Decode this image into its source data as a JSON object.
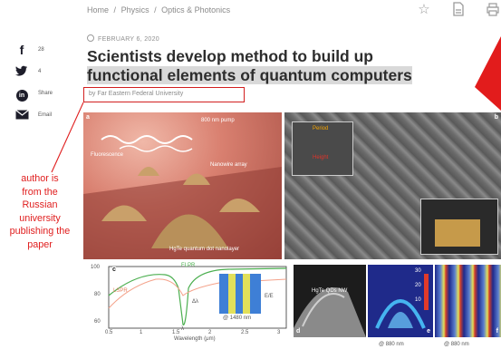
{
  "breadcrumb": {
    "items": [
      "Home",
      "Physics",
      "Optics & Photonics"
    ],
    "separator": "/"
  },
  "toolbar_icons": [
    "star-icon",
    "document-icon",
    "print-icon"
  ],
  "article": {
    "date": "FEBRUARY 6, 2020",
    "title_line1": "Scientists develop method to build up",
    "title_line2": "functional elements of quantum computers",
    "byline": "by Far Eastern Federal University"
  },
  "share": {
    "facebook_count": "28",
    "twitter_count": "4",
    "linkedin_label": "Share",
    "email_label": "Email"
  },
  "annotation": {
    "text": "author is from the Russian university publishing the paper",
    "line1": "author is",
    "line2": "from the",
    "line3": "Russian",
    "line4": "university",
    "line5": "publishing  the",
    "line6": "paper",
    "color": "#e01e1e"
  },
  "figure": {
    "panel_a": {
      "letter": "a",
      "labels": [
        "800 nm pump",
        "Nanowire array",
        "HgTe quantum dot nanolayer",
        "Fluorescence"
      ]
    },
    "panel_b": {
      "letter": "b",
      "labels": [
        "Period",
        "Height"
      ]
    },
    "panel_c": {
      "letter": "c",
      "curve_labels": [
        "FLPR",
        "LSPR"
      ],
      "annotation_fwhm": "Δλ",
      "annotation_lambda": "λ",
      "inset_caption": "@ 1480 nm",
      "inset_axis_label": "E/E",
      "x_axis_label": "Wavelength (μm)",
      "x_ticks": [
        "0.5",
        "1",
        "1.5",
        "2",
        "2.5",
        "3"
      ],
      "y_ticks": [
        "100",
        "80",
        "60"
      ]
    },
    "panel_d": {
      "letter": "d",
      "label": "HgTe QDs NW"
    },
    "panel_e": {
      "letter": "e",
      "caption": "@ 880 nm",
      "color_scale": [
        "30",
        "20",
        "10"
      ]
    },
    "panel_f": {
      "letter": "f",
      "caption": "@ 880 nm"
    }
  }
}
